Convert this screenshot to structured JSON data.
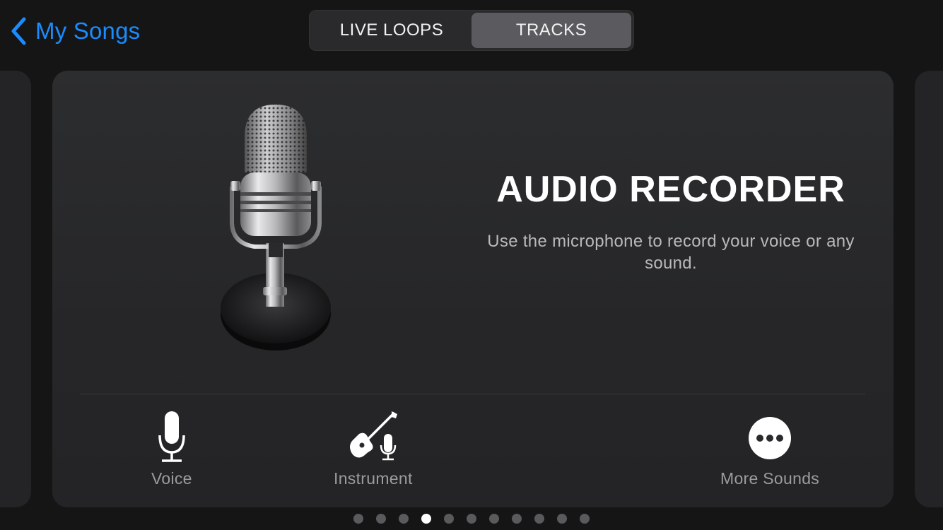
{
  "nav": {
    "back_label": "My Songs",
    "tabs": [
      {
        "label": "LIVE LOOPS",
        "active": false
      },
      {
        "label": "TRACKS",
        "active": true
      }
    ]
  },
  "card": {
    "title": "AUDIO RECORDER",
    "description": "Use the microphone to record your voice or any sound.",
    "illustration": "vintage-microphone",
    "options": [
      {
        "label": "Voice",
        "icon": "microphone-icon"
      },
      {
        "label": "Instrument",
        "icon": "guitar-microphone-icon"
      },
      {
        "label": "More Sounds",
        "icon": "more-icon"
      }
    ]
  },
  "pager": {
    "count": 11,
    "active_index": 3
  },
  "colors": {
    "accent": "#1a8cff",
    "background": "#151516",
    "card": "#2a2a2c",
    "segment_active": "#5b5b5f"
  }
}
